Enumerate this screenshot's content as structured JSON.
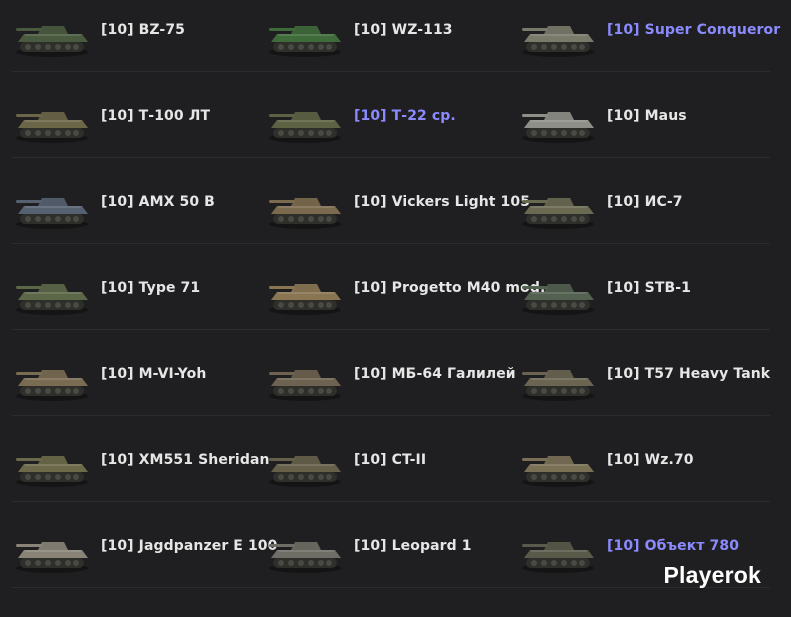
{
  "items": [
    {
      "label": "[10] BZ-75",
      "highlight": false,
      "color": "#4a5a3e"
    },
    {
      "label": "[10] WZ-113",
      "highlight": false,
      "color": "#3f6a3a"
    },
    {
      "label": "[10] Super Conqueror",
      "highlight": true,
      "color": "#7a7a6a"
    },
    {
      "label": "[10] Т-100 ЛТ",
      "highlight": false,
      "color": "#6c6648"
    },
    {
      "label": "[10] Т-22 ср.",
      "highlight": true,
      "color": "#5d6244"
    },
    {
      "label": "[10] Maus",
      "highlight": false,
      "color": "#8f8f8a"
    },
    {
      "label": "[10] AMX 50 B",
      "highlight": false,
      "color": "#556070"
    },
    {
      "label": "[10] Vickers Light 105",
      "highlight": false,
      "color": "#7c6a4e"
    },
    {
      "label": "[10] ИС-7",
      "highlight": false,
      "color": "#6a6a52"
    },
    {
      "label": "[10] Type 71",
      "highlight": false,
      "color": "#5c6748"
    },
    {
      "label": "[10] Progetto M40 mod.",
      "highlight": false,
      "color": "#8a7552"
    },
    {
      "label": "[10] STB-1",
      "highlight": false,
      "color": "#526150"
    },
    {
      "label": "[10] M-VI-Yoh",
      "highlight": false,
      "color": "#7a6c52"
    },
    {
      "label": "[10] МБ-64 Галилей",
      "highlight": false,
      "color": "#6e6250"
    },
    {
      "label": "[10] T57 Heavy Tank",
      "highlight": false,
      "color": "#6a6450"
    },
    {
      "label": "[10] XM551 Sheridan",
      "highlight": false,
      "color": "#6c6a4a"
    },
    {
      "label": "[10] CT-II",
      "highlight": false,
      "color": "#66604a"
    },
    {
      "label": "[10] Wz.70",
      "highlight": false,
      "color": "#7a7056"
    },
    {
      "label": "[10] Jagdpanzer E 100",
      "highlight": false,
      "color": "#8a8478"
    },
    {
      "label": "[10] Leopard 1",
      "highlight": false,
      "color": "#6e6e66"
    },
    {
      "label": "[10] Объект 780",
      "highlight": true,
      "color": "#5a5a4a"
    }
  ],
  "brand": "Playerok",
  "colors": {
    "background": "#1f1f21",
    "text": "#e6e6e6",
    "highlight_text": "#8b8bff",
    "divider": "#2c2c2f"
  }
}
